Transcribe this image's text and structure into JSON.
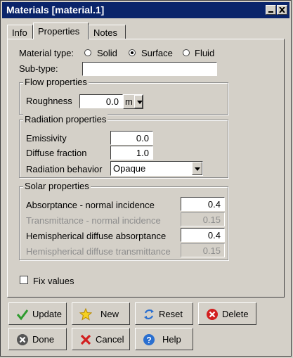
{
  "window": {
    "title": "Materials [material.1]"
  },
  "tabs": [
    {
      "label": "Info"
    },
    {
      "label": "Properties"
    },
    {
      "label": "Notes"
    }
  ],
  "material_type": {
    "label": "Material type:",
    "options": [
      {
        "label": "Solid"
      },
      {
        "label": "Surface"
      },
      {
        "label": "Fluid"
      }
    ],
    "selected": "Surface"
  },
  "subtype": {
    "label": "Sub-type:",
    "value": ""
  },
  "flow": {
    "title": "Flow properties",
    "roughness_label": "Roughness",
    "roughness_value": "0.0",
    "roughness_unit": "m"
  },
  "radiation": {
    "title": "Radiation properties",
    "emissivity_label": "Emissivity",
    "emissivity_value": "0.0",
    "diffuse_label": "Diffuse fraction",
    "diffuse_value": "1.0",
    "behavior_label": "Radiation behavior",
    "behavior_value": "Opaque"
  },
  "solar": {
    "title": "Solar properties",
    "rows": [
      {
        "label": "Absorptance - normal incidence",
        "value": "0.4"
      },
      {
        "label": "Transmittance - normal incidence",
        "value": "0.15"
      },
      {
        "label": "Hemispherical diffuse absorptance",
        "value": "0.4"
      },
      {
        "label": "Hemispherical diffuse transmittance",
        "value": "0.15"
      }
    ]
  },
  "fix_values": {
    "label": "Fix values"
  },
  "buttons": {
    "update": "Update",
    "new": "New",
    "reset": "Reset",
    "delete": "Delete",
    "done": "Done",
    "cancel": "Cancel",
    "help": "Help"
  },
  "colors": {
    "title_bg": "#0a246a",
    "face": "#d4d0c8",
    "disabled_text": "#8d8d8d"
  }
}
